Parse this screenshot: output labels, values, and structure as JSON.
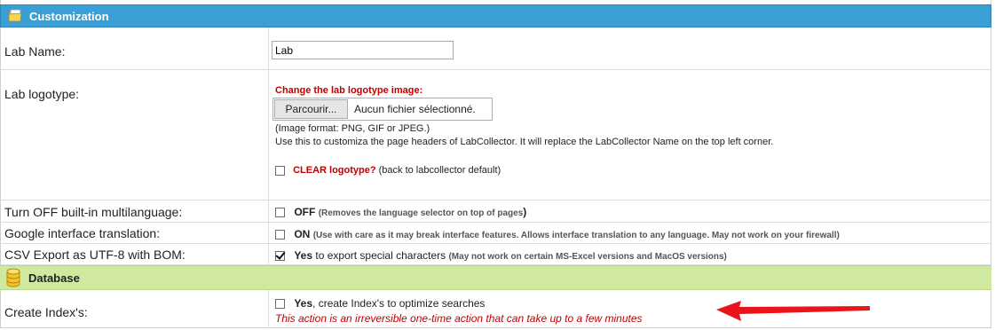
{
  "customization": {
    "title": "Customization",
    "icon": "folder-icon"
  },
  "lab_name": {
    "label": "Lab Name:",
    "value": "Lab"
  },
  "lab_logotype": {
    "label": "Lab logotype:",
    "change_title": "Change the lab logotype image:",
    "browse_label": "Parcourir...",
    "no_file": "Aucun fichier sélectionné.",
    "format_note": "(Image format: PNG, GIF or JPEG.)",
    "usage_note": "Use this to customiza the page headers of LabCollector. It will replace the LabCollector Name on the top left corner.",
    "clear_label": "CLEAR logotype?",
    "clear_note": " (back to labcollector default)",
    "clear_checked": false
  },
  "multilanguage": {
    "label": "Turn OFF built-in multilanguage:",
    "option": "OFF",
    "note": "(Removes the language selector on top of pages",
    "note_close": ")",
    "checked": false
  },
  "google_translation": {
    "label": "Google interface translation:",
    "option": "ON",
    "note": "(Use with care as it may break interface features. Allows interface translation to any language. May not work on your firewall)",
    "checked": false
  },
  "csv_export": {
    "label": "CSV Export as UTF-8 with BOM:",
    "option": "Yes",
    "option_rest": " to export special characters",
    "note": "(May not work on certain MS-Excel versions and MacOS versions)",
    "checked": true
  },
  "database": {
    "title": "Database",
    "icon": "database-icon"
  },
  "create_index": {
    "label": "Create Index's:",
    "option": "Yes",
    "option_rest": ", create Index's to optimize searches",
    "warning": "This action is an irreversible one-time action that can take up to a few minutes",
    "checked": false
  },
  "colors": {
    "customization_header": "#3a9fd4",
    "database_header": "#cfe9a1",
    "warning_text": "#c00000",
    "arrow": "#e8161b"
  }
}
